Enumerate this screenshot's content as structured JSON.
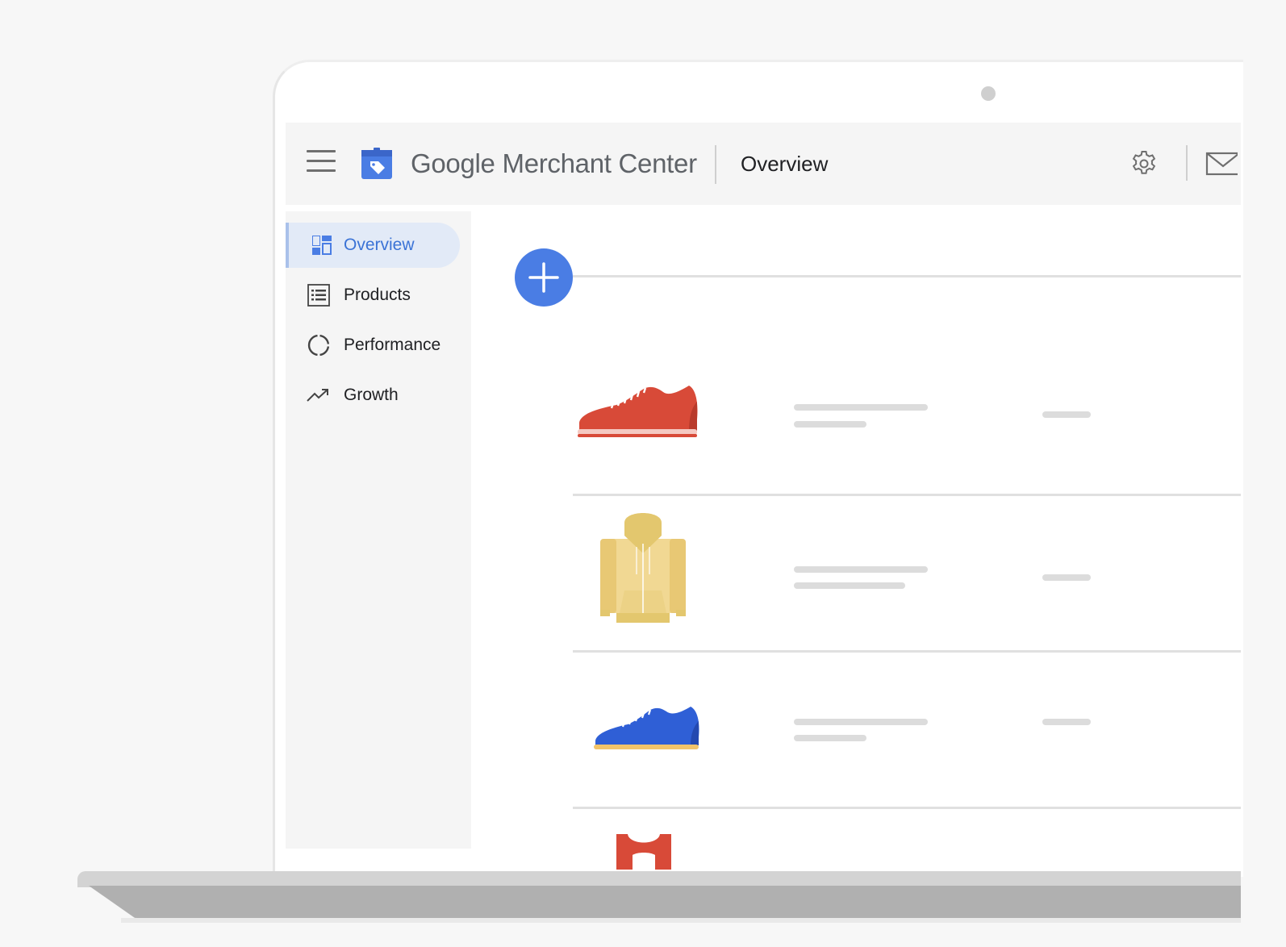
{
  "app": {
    "brand_google": "Google",
    "brand_product": "Merchant Center",
    "page_title": "Overview"
  },
  "sidebar": {
    "items": [
      {
        "label": "Overview",
        "icon": "dashboard-icon",
        "active": true
      },
      {
        "label": "Products",
        "icon": "list-icon",
        "active": false
      },
      {
        "label": "Performance",
        "icon": "donut-icon",
        "active": false
      },
      {
        "label": "Growth",
        "icon": "trending-up-icon",
        "active": false
      }
    ]
  },
  "products": [
    {
      "icon": "red-sneaker-icon"
    },
    {
      "icon": "yellow-hoodie-icon"
    },
    {
      "icon": "blue-sneaker-icon"
    },
    {
      "icon": "red-tank-top-icon"
    }
  ],
  "colors": {
    "accent": "#4a7de4",
    "active_text": "#3b73d6",
    "active_bg": "#e2eaf7",
    "red_product": "#d84a38",
    "yellow_product": "#f1d893",
    "blue_product": "#2f5fd6"
  }
}
